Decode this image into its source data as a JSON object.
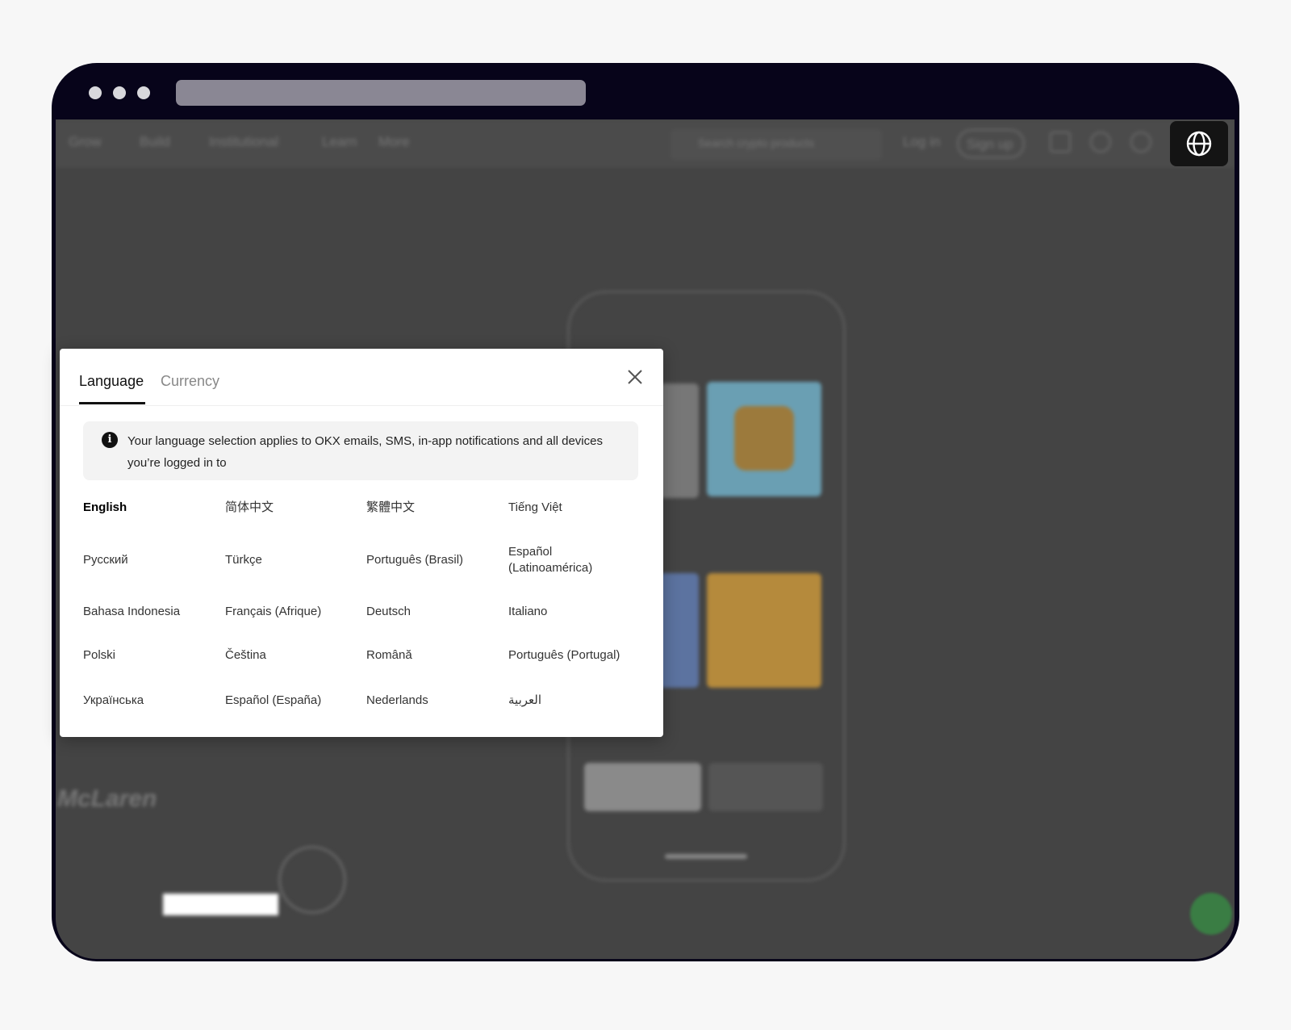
{
  "browser": {
    "window_dots": 3
  },
  "nav": {
    "items": [
      "Grow",
      "Build",
      "Institutional",
      "Learn",
      "More"
    ],
    "search_placeholder": "Search crypto products",
    "login": "Log in",
    "signup": "Sign up"
  },
  "modal": {
    "tabs": [
      {
        "label": "Language",
        "active": true
      },
      {
        "label": "Currency",
        "active": false
      }
    ],
    "info": "Your language selection applies to OKX emails, SMS, in-app notifications and all devices you’re logged in to",
    "languages": [
      "English",
      "简体中文",
      "繁體中文",
      "Tiếng Việt",
      "Русский",
      "Türkçe",
      "Português (Brasil)",
      "Español (Latinoamérica)",
      "Bahasa Indonesia",
      "Français (Afrique)",
      "Deutsch",
      "Italiano",
      "Polski",
      "Čeština",
      "Română",
      "Português (Portugal)",
      "Українська",
      "Español (España)",
      "Nederlands",
      "العربية"
    ],
    "selected": "English"
  },
  "colors": {
    "titlebar": "#07041a",
    "overlay": "#444444",
    "accent_chat": "#3a7d44"
  }
}
